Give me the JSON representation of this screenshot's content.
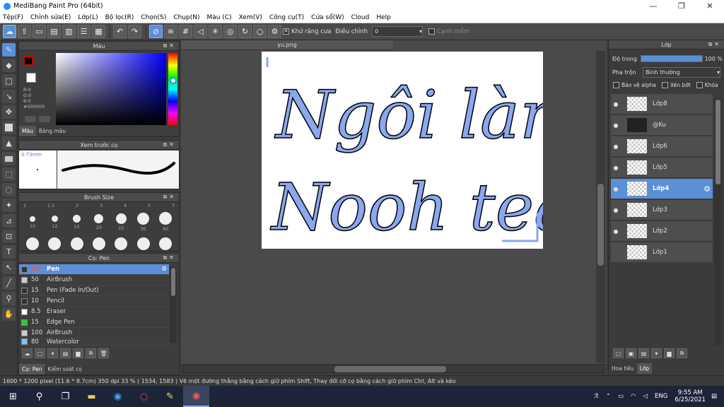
{
  "window": {
    "title": "MediBang Paint Pro (64bit)",
    "minimize": "—",
    "maximize": "❐",
    "close": "✕"
  },
  "menu": [
    "Tệp(F)",
    "Chỉnh sửa(E)",
    "Lớp(L)",
    "Bộ lọc(R)",
    "Chọn(S)",
    "Chụp(N)",
    "Màu (C)",
    "Xem(V)",
    "Công cụ(T)",
    "Cửa sổ(W)",
    "Cloud",
    "Help"
  ],
  "toolbar": {
    "antialias": "Khử răng cưa",
    "correction_label": "Điều chỉnh",
    "correction_value": "0",
    "edge_label": "Cạnh mềm"
  },
  "color_panel": {
    "title": "Màu",
    "r": "R:0",
    "g": "G:0",
    "b": "B:0",
    "hex": "#000000",
    "tab_color": "Màu",
    "tab_palette": "Bảng màu"
  },
  "brush_preview": {
    "title": "Xem trước cọ",
    "size": "0.73mm"
  },
  "brush_size": {
    "title": "Brush Size",
    "top_labels": [
      "1",
      "1.5",
      "2",
      "3",
      "4",
      "5",
      "7"
    ],
    "labels": [
      "10",
      "12",
      "15",
      "20",
      "25",
      "30",
      "40"
    ]
  },
  "brush_list": {
    "title": "Cọ: Pen",
    "items": [
      {
        "size": "10",
        "name": "Pen",
        "color": "#333333"
      },
      {
        "size": "50",
        "name": "AirBrush",
        "color": "#cccccc"
      },
      {
        "size": "15",
        "name": "Pen (Fade In/Out)",
        "color": "#333333"
      },
      {
        "size": "10",
        "name": "Pencil",
        "color": "#333333"
      },
      {
        "size": "8.5",
        "name": "Eraser",
        "color": "#ffffff"
      },
      {
        "size": "15",
        "name": "Edge Pen",
        "color": "#2ecc2e"
      },
      {
        "size": "100",
        "name": "AirBrush",
        "color": "#cccccc"
      },
      {
        "size": "80",
        "name": "Watercolor",
        "color": "#7fbfff"
      }
    ],
    "tab_pen": "Cọ: Pen",
    "tab_control": "Kiểm soát cọ"
  },
  "document": {
    "tab": "yu.png",
    "line1": "Ngôi làng",
    "line2": "Nooh team"
  },
  "layers": {
    "title": "Lớp",
    "opacity_label": "Độ trong",
    "opacity_value": "100 %",
    "opacity_fraction": 1.0,
    "blend_label": "Pha trộn",
    "blend_value": "Bình thường",
    "protect_alpha": "Bảo vệ alpha",
    "clipping": "Xén bớt",
    "lock": "Khóa",
    "items": [
      "Lớp8",
      "@Ku",
      "Lớp6",
      "Lớp5",
      "Lớp4",
      "Lớp3",
      "Lớp2",
      "Lớp1"
    ],
    "selected": "Lớp4",
    "tab_material": "Hoa tiêu",
    "tab_layer": "Lớp"
  },
  "status": "1600 * 1200 pixel   (11.6 * 8.7cm)   350 dpi   33 %   ( 1534, 1583 )   Vẽ một đường thẳng bằng cách giữ phím Shift, Thay đổi cỡ cọ bằng cách giữ phím Ctrl, Alt và kéo",
  "taskbar": {
    "lang": "ENG",
    "time": "9:55 AM",
    "date": "6/25/2021"
  }
}
